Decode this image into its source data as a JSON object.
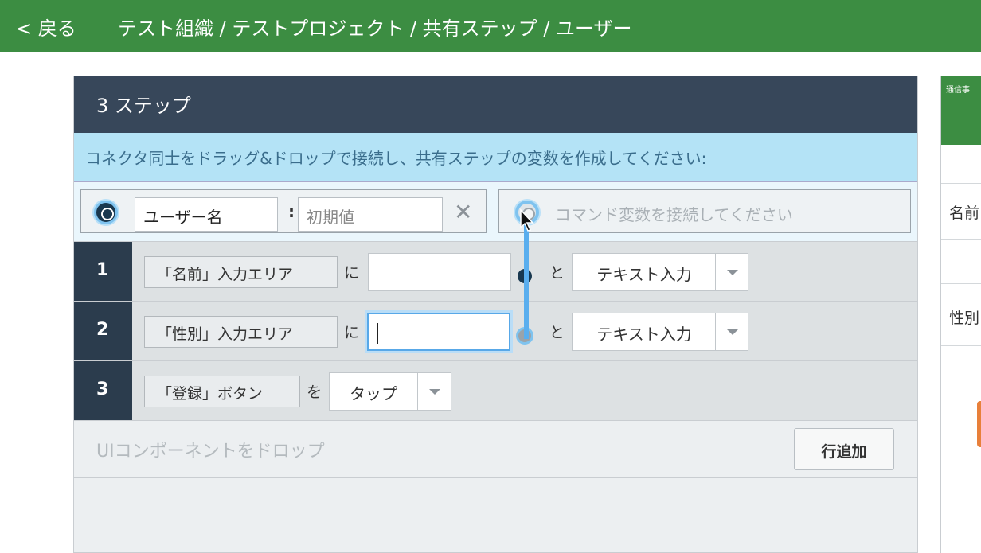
{
  "header": {
    "back_label": "< 戻る",
    "breadcrumb": "テスト組織 / テストプロジェクト / 共有ステップ / ユーザー"
  },
  "panel": {
    "title": "3 ステップ",
    "hint": "コネクタ同士をドラッグ&ドロップで接続し、共有ステップの変数を作成してください:",
    "variable": {
      "name_value": "ユーザー名",
      "colon": ":",
      "initial_placeholder": "初期値",
      "command_placeholder": "コマンド変数を接続してください"
    },
    "steps": [
      {
        "num": "1",
        "component": "「名前」入力エリア",
        "particle": "に",
        "value": "",
        "to": "と",
        "action": "テキスト入力"
      },
      {
        "num": "2",
        "component": "「性別」入力エリア",
        "particle": "に",
        "value": "",
        "to": "と",
        "action": "テキスト入力"
      },
      {
        "num": "3",
        "component": "「登録」ボタン",
        "particle": "を",
        "action": "タップ"
      }
    ],
    "drop_placeholder": "UIコンポーネントをドロップ",
    "add_row_label": "行追加"
  },
  "right_panel": {
    "header_text": "通信事",
    "row1": "名前",
    "row2": "性別"
  },
  "colors": {
    "topbar": "#3c8d42",
    "panel_header": "#37475a",
    "hint_bg": "#b4e3f6",
    "connector_line": "#5aaeee",
    "step_number_bg": "#2b3c4d"
  }
}
